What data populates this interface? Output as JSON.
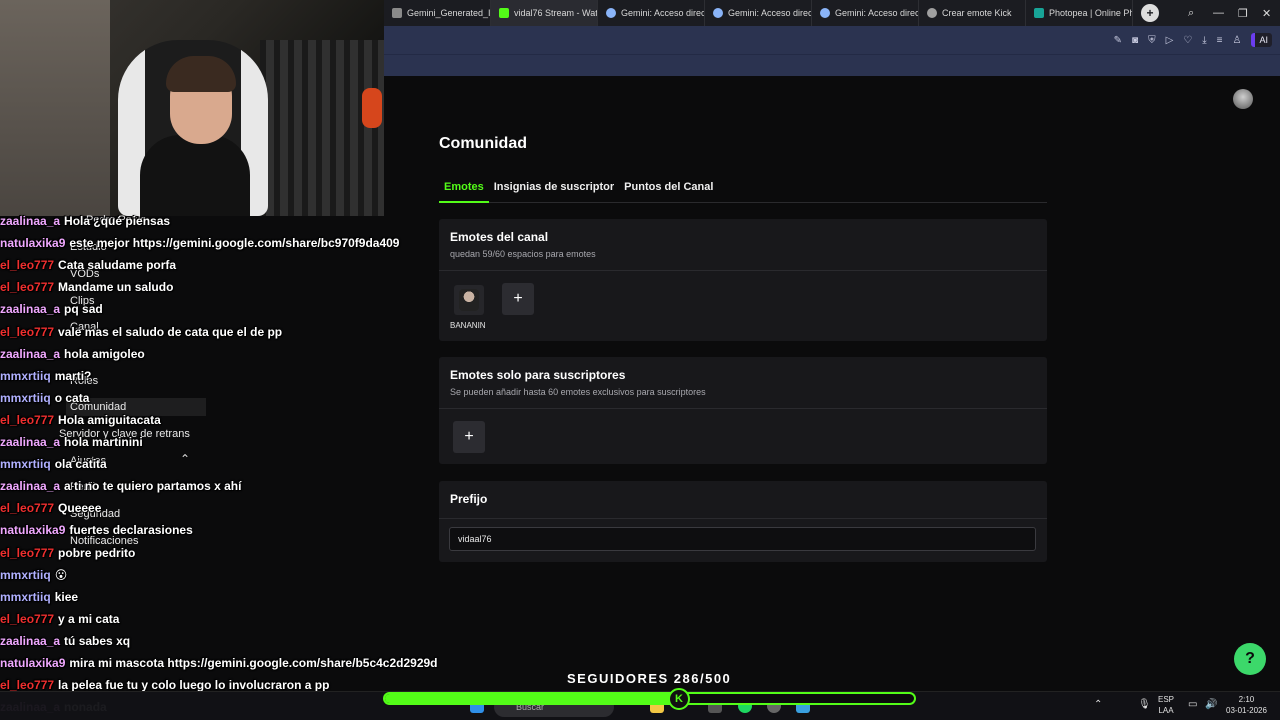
{
  "browser": {
    "tabs": [
      {
        "label": "Gemini_Generated_Imag",
        "icon": "image-icon",
        "color": "#8a8a8a"
      },
      {
        "label": "vidal76 Stream - Watch L",
        "icon": "kick-icon",
        "color": "#53fc18"
      },
      {
        "label": "Gemini: Acceso directo a",
        "icon": "gemini-icon",
        "color": "#8ab4f8"
      },
      {
        "label": "Gemini: Acceso directo a",
        "icon": "gemini-icon",
        "color": "#8ab4f8"
      },
      {
        "label": "Gemini: Acceso directo a",
        "icon": "gemini-icon",
        "color": "#8ab4f8"
      },
      {
        "label": "Crear emote Kick",
        "icon": "globe-icon",
        "color": "#a0a0a0"
      },
      {
        "label": "Photopea | Online Photo",
        "icon": "photopea-icon",
        "color": "#18a497"
      }
    ],
    "ai_label": "AI"
  },
  "page": {
    "title": "Comunidad",
    "tabs": [
      "Emotes",
      "Insignias de suscriptor",
      "Puntos del Canal"
    ],
    "channel_emotes": {
      "title": "Emotes del canal",
      "subtitle": "quedan 59/60 espacios para emotes",
      "emote_name": "BANANIN"
    },
    "sub_emotes": {
      "title": "Emotes solo para suscriptores",
      "subtitle": "Se pueden añadir hasta 60 emotes exclusivos para suscriptores"
    },
    "prefix": {
      "title": "Prefijo",
      "value": "vidaal76"
    },
    "add_symbol": "+"
  },
  "sidebar_ghost": {
    "items": [
      "Pedro Pablo",
      "Estudio",
      "VODs",
      "Clips",
      "Canal",
      "Roles",
      "Comunidad",
      "Servidor y clave de retrans",
      "Ajustes",
      "Perfil",
      "Seguridad",
      "Notificaciones"
    ]
  },
  "chat": [
    {
      "user": "zaalinaa_a",
      "msg": "Hola ¿qué piensas",
      "color": "#f0a8ff"
    },
    {
      "user": "natulaxika9",
      "msg": "este mejor https://gemini.google.com/share/bc970f9da409",
      "color": "#f0a8ff"
    },
    {
      "user": "el_leo777",
      "msg": "Cata saludame porfa",
      "color": "#ef2f2f"
    },
    {
      "user": "el_leo777",
      "msg": "Mandame un saludo",
      "color": "#ef2f2f"
    },
    {
      "user": "zaalinaa_a",
      "msg": "pq sad",
      "color": "#f0a8ff"
    },
    {
      "user": "el_leo777",
      "msg": "vale mas el saludo de cata que el de pp",
      "color": "#ef2f2f"
    },
    {
      "user": "zaalinaa_a",
      "msg": "hola amigoleo",
      "color": "#f0a8ff"
    },
    {
      "user": "mmxrtiiq",
      "msg": "marti?",
      "color": "#b0b0ff"
    },
    {
      "user": "mmxrtiiq",
      "msg": "o cata",
      "color": "#b0b0ff"
    },
    {
      "user": "el_leo777",
      "msg": "Hola amiguitacata",
      "color": "#ef2f2f"
    },
    {
      "user": "zaalinaa_a",
      "msg": "hola martinini",
      "color": "#f0a8ff"
    },
    {
      "user": "mmxrtiiq",
      "msg": "ola catita",
      "color": "#b0b0ff"
    },
    {
      "user": "zaalinaa_a",
      "msg": "a ti no te quiero partamos x ahí",
      "color": "#f0a8ff"
    },
    {
      "user": "el_leo777",
      "msg": "Queeee",
      "color": "#ef2f2f"
    },
    {
      "user": "natulaxika9",
      "msg": "fuertes declarasiones",
      "color": "#f0a8ff"
    },
    {
      "user": "el_leo777",
      "msg": "pobre pedrito",
      "color": "#ef2f2f"
    },
    {
      "user": "mmxrtiiq",
      "msg": "😮",
      "color": "#b0b0ff"
    },
    {
      "user": "mmxrtiiq",
      "msg": "kiee",
      "color": "#b0b0ff"
    },
    {
      "user": "el_leo777",
      "msg": "y a mi cata",
      "color": "#ef2f2f"
    },
    {
      "user": "zaalinaa_a",
      "msg": "tú sabes xq",
      "color": "#f0a8ff"
    },
    {
      "user": "natulaxika9",
      "msg": "mira mi mascota https://gemini.google.com/share/b5c4c2d2929d",
      "color": "#f0a8ff"
    },
    {
      "user": "el_leo777",
      "msg": "la pelea fue tu y colo luego lo involucraron a pp",
      "color": "#ef2f2f"
    },
    {
      "user": "zaalinaa_a",
      "msg": "nonada",
      "color": "#f0a8ff"
    }
  ],
  "goal": {
    "label": "SEGUIDORES 286/500",
    "current": 286,
    "target": 500,
    "knob": "K"
  },
  "taskbar": {
    "search_placeholder": "Buscar",
    "lang_top": "ESP",
    "lang_bottom": "LAA",
    "time": "2:10",
    "date": "03-01-2026"
  }
}
